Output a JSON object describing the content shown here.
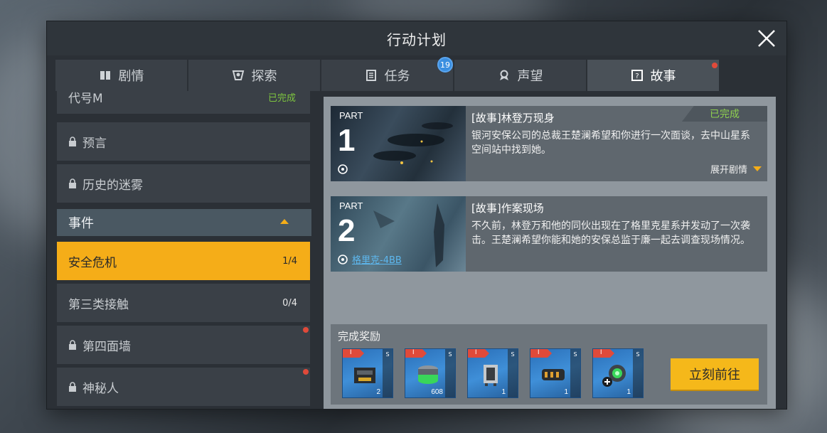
{
  "window": {
    "title": "行动计划",
    "close_icon": "close-icon"
  },
  "tabs": [
    {
      "label": "剧情",
      "icon": "book-icon",
      "active": false
    },
    {
      "label": "探索",
      "icon": "compass-icon",
      "active": false
    },
    {
      "label": "任务",
      "icon": "clipboard-icon",
      "active": false,
      "badge": "19"
    },
    {
      "label": "声望",
      "icon": "medal-icon",
      "active": false
    },
    {
      "label": "故事",
      "icon": "story-icon",
      "active": true,
      "red_dot": true
    }
  ],
  "sidebar": {
    "items_top": [
      {
        "label": "代号M",
        "status": "已完成",
        "locked": false
      },
      {
        "label": "预言",
        "locked": true
      },
      {
        "label": "历史的迷雾",
        "locked": true
      }
    ],
    "section_label": "事件",
    "events": [
      {
        "label": "安全危机",
        "count": "1/4",
        "selected": true
      },
      {
        "label": "第三类接触",
        "count": "0/4",
        "selected": false
      },
      {
        "label": "第四面墙",
        "locked": true,
        "red_dot": true
      },
      {
        "label": "神秘人",
        "locked": true,
        "red_dot": true
      }
    ]
  },
  "story_cards": [
    {
      "part_label": "PART",
      "part_number": "1",
      "title": "[故事]林登万现身",
      "description": "银河安保公司的总裁王楚澜希望和你进行一次面谈，去中山星系空间站中找到她。",
      "status": "已完成",
      "expand_label": "展开剧情"
    },
    {
      "part_label": "PART",
      "part_number": "2",
      "title": "[故事]作案现场",
      "description": "不久前，林登万和他的同伙出现在了格里克星系并发动了一次袭击。王楚澜希望你能和她的安保总监于廉一起去调查现场情况。",
      "location": "格里克-4BB"
    }
  ],
  "rewards": {
    "label": "完成奖励",
    "items": [
      {
        "tier": "I",
        "grade": "S",
        "qty": "2",
        "icon": "armor-module-icon"
      },
      {
        "tier": "I",
        "grade": "S",
        "qty": "608",
        "icon": "green-canister-icon"
      },
      {
        "tier": "I",
        "grade": "S",
        "qty": "1",
        "icon": "mech-part-icon"
      },
      {
        "tier": "I",
        "grade": "S",
        "qty": "1",
        "icon": "engine-icon"
      },
      {
        "tier": "I",
        "grade": "S",
        "qty": "1",
        "icon": "green-core-icon"
      }
    ],
    "go_button": "立刻前往"
  },
  "colors": {
    "accent": "#f5ad18",
    "complete": "#7ec63f",
    "link": "#5db7ee",
    "badge": "#3b8fe0",
    "alert": "#e04a3a"
  }
}
